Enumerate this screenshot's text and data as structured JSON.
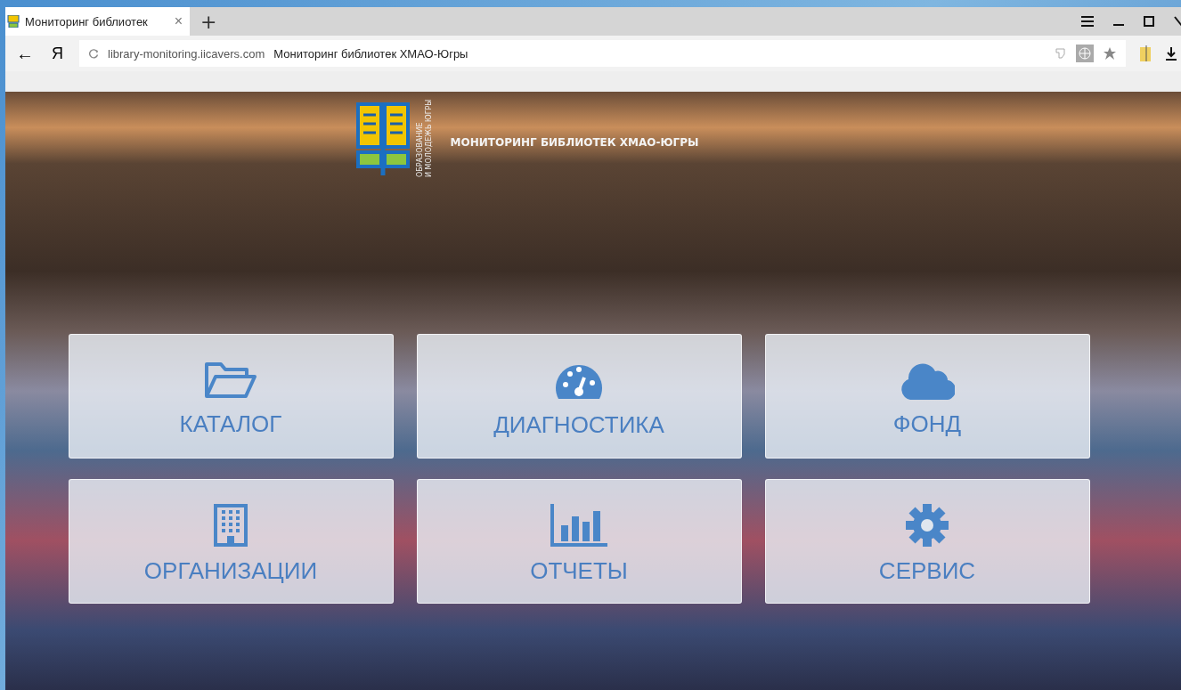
{
  "browser": {
    "tab_title": "Мониторинг библиотек",
    "tab_close": "×",
    "new_tab": "+",
    "back": "←",
    "home": "Я",
    "url_host": "library-monitoring.iicavers.com",
    "page_title": "Мониторинг библиотек ХМАО-Югры"
  },
  "header": {
    "title": "МОНИТОРИНГ БИБЛИОТЕК ХМАО-ЮГРЫ",
    "logo_caption": [
      "ОБРАЗОВАНИЕ",
      "И МОЛОДЕЖЬ ЮГРЫ"
    ]
  },
  "tiles": [
    {
      "label": "КАТАЛОГ",
      "kind": "folder"
    },
    {
      "label": "ДИАГНОСТИКА",
      "kind": "gauge"
    },
    {
      "label": "ФОНД",
      "kind": "cloud"
    },
    {
      "label": "ОРГАНИЗАЦИИ",
      "kind": "building"
    },
    {
      "label": "ОТЧЕТЫ",
      "kind": "chart"
    },
    {
      "label": "СЕРВИС",
      "kind": "gear"
    }
  ]
}
